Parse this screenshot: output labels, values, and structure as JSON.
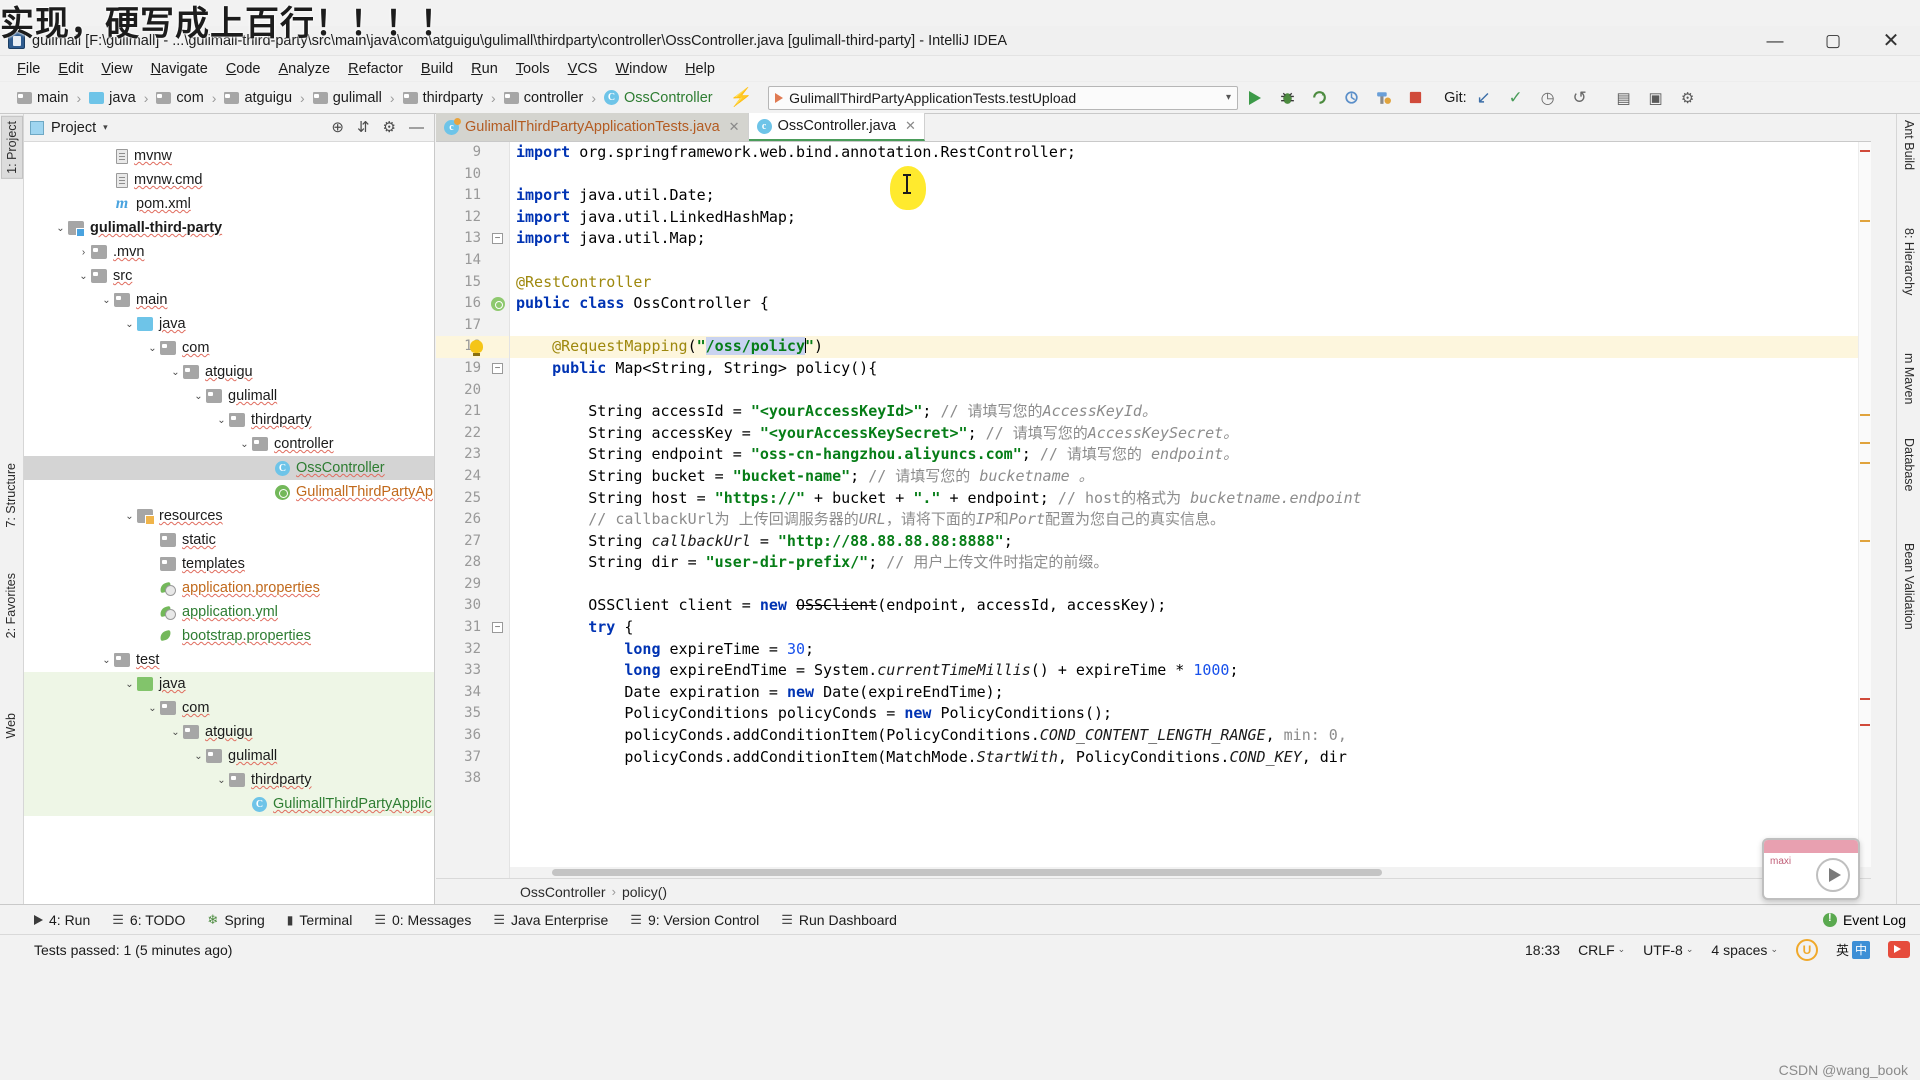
{
  "overlay": {
    "banner_text": "实现，硬写成上百行！！！！"
  },
  "titlebar": {
    "text": "gulimall [F:\\gulimall] - ...\\gulimall-third-party\\src\\main\\java\\com\\atguigu\\gulimall\\thirdparty\\controller\\OssController.java [gulimall-third-party] - IntelliJ IDEA",
    "app_icon": "intellij-idea-icon",
    "minimize": "—",
    "maximize": "▢",
    "close": "✕"
  },
  "menubar": {
    "items": [
      "File",
      "Edit",
      "View",
      "Navigate",
      "Code",
      "Analyze",
      "Refactor",
      "Build",
      "Run",
      "Tools",
      "VCS",
      "Window",
      "Help"
    ]
  },
  "navbar": {
    "breadcrumb": [
      {
        "label": "main",
        "icon": "folder-icon"
      },
      {
        "label": "java",
        "icon": "folder-source-icon"
      },
      {
        "label": "com",
        "icon": "folder-icon"
      },
      {
        "label": "atguigu",
        "icon": "folder-icon"
      },
      {
        "label": "gulimall",
        "icon": "folder-icon"
      },
      {
        "label": "thirdparty",
        "icon": "folder-icon"
      },
      {
        "label": "controller",
        "icon": "folder-icon"
      },
      {
        "label": "OssController",
        "icon": "java-class-icon"
      }
    ],
    "separator": "›",
    "lightning_icon": "lightning-bolt-icon",
    "run_config": {
      "name": "GulimallThirdPartyApplicationTests.testUpload",
      "chevron": "▾"
    },
    "buttons": [
      {
        "name": "run-button",
        "glyph": "▶"
      },
      {
        "name": "debug-button",
        "glyph": "🐞"
      },
      {
        "name": "run-coverage-button",
        "glyph": "⟳"
      },
      {
        "name": "profiler-button",
        "glyph": "⚙"
      },
      {
        "name": "build-project-button",
        "glyph": "🔨"
      },
      {
        "name": "stop-button",
        "glyph": "■"
      }
    ],
    "git_label": "Git:",
    "git_buttons": [
      {
        "name": "update-project-button",
        "glyph": "↙"
      },
      {
        "name": "commit-button",
        "glyph": "✓"
      },
      {
        "name": "history-button",
        "glyph": "◷"
      },
      {
        "name": "rollback-button",
        "glyph": "↺"
      }
    ],
    "right_buttons": [
      {
        "name": "layout-button",
        "glyph": "▦"
      },
      {
        "name": "search-everywhere-button",
        "glyph": "⌕"
      },
      {
        "name": "settings-button",
        "glyph": "⚙"
      }
    ]
  },
  "left_strip": {
    "tabs": [
      {
        "label": "1: Project",
        "active": true
      },
      {
        "label": "7: Structure",
        "active": false
      },
      {
        "label": "2: Favorites",
        "active": false
      },
      {
        "label": "Web",
        "active": false
      }
    ]
  },
  "right_strip": {
    "tabs": [
      {
        "label": "Ant Build"
      },
      {
        "label": "8: Hierarchy"
      },
      {
        "label": "m Maven"
      },
      {
        "label": "Database"
      },
      {
        "label": "Bean Validation"
      }
    ]
  },
  "project_panel": {
    "title": "Project",
    "chevron": "▾",
    "locate_icon": "crosshair-icon",
    "collapse_icon": "collapse-all-icon",
    "settings_icon": "gear-icon",
    "hide_icon": "minimize-icon",
    "tree": [
      {
        "label": "mvnw",
        "indent": 3,
        "arrow": "",
        "icon": "file-icon",
        "style": ""
      },
      {
        "label": "mvnw.cmd",
        "indent": 3,
        "arrow": "",
        "icon": "file-icon",
        "style": ""
      },
      {
        "label": "pom.xml",
        "indent": 3,
        "arrow": "",
        "icon": "maven-file-icon",
        "style": ""
      },
      {
        "label": "gulimall-third-party",
        "indent": 1,
        "arrow": "⌄",
        "icon": "module-folder-icon",
        "style": "bold"
      },
      {
        "label": ".mvn",
        "indent": 2,
        "arrow": "›",
        "icon": "folder-icon",
        "style": ""
      },
      {
        "label": "src",
        "indent": 2,
        "arrow": "⌄",
        "icon": "folder-icon",
        "style": ""
      },
      {
        "label": "main",
        "indent": 3,
        "arrow": "⌄",
        "icon": "folder-icon",
        "style": ""
      },
      {
        "label": "java",
        "indent": 4,
        "arrow": "⌄",
        "icon": "folder-source-icon",
        "style": ""
      },
      {
        "label": "com",
        "indent": 5,
        "arrow": "⌄",
        "icon": "folder-icon",
        "style": ""
      },
      {
        "label": "atguigu",
        "indent": 6,
        "arrow": "⌄",
        "icon": "folder-icon",
        "style": ""
      },
      {
        "label": "gulimall",
        "indent": 7,
        "arrow": "⌄",
        "icon": "folder-icon",
        "style": ""
      },
      {
        "label": "thirdparty",
        "indent": 8,
        "arrow": "⌄",
        "icon": "folder-icon",
        "style": ""
      },
      {
        "label": "controller",
        "indent": 9,
        "arrow": "⌄",
        "icon": "folder-icon",
        "style": ""
      },
      {
        "label": "OssController",
        "indent": 10,
        "arrow": "",
        "icon": "java-class-icon",
        "style": "selected-green"
      },
      {
        "label": "GulimallThirdPartyApplication",
        "indent": 10,
        "arrow": "",
        "icon": "spring-class-icon",
        "style": "orange"
      },
      {
        "label": "resources",
        "indent": 4,
        "arrow": "⌄",
        "icon": "resources-folder-icon",
        "style": ""
      },
      {
        "label": "static",
        "indent": 5,
        "arrow": "",
        "icon": "folder-icon",
        "style": ""
      },
      {
        "label": "templates",
        "indent": 5,
        "arrow": "",
        "icon": "folder-icon",
        "style": ""
      },
      {
        "label": "application.properties",
        "indent": 5,
        "arrow": "",
        "icon": "spring-config-icon",
        "style": "orange"
      },
      {
        "label": "application.yml",
        "indent": 5,
        "arrow": "",
        "icon": "spring-config-icon",
        "style": "green"
      },
      {
        "label": "bootstrap.properties",
        "indent": 5,
        "arrow": "",
        "icon": "spring-leaf-icon",
        "style": "green"
      },
      {
        "label": "test",
        "indent": 3,
        "arrow": "⌄",
        "icon": "folder-icon",
        "style": ""
      },
      {
        "label": "java",
        "indent": 4,
        "arrow": "⌄",
        "icon": "folder-test-icon",
        "style": "testrow"
      },
      {
        "label": "com",
        "indent": 5,
        "arrow": "⌄",
        "icon": "folder-icon",
        "style": "testrow"
      },
      {
        "label": "atguigu",
        "indent": 6,
        "arrow": "⌄",
        "icon": "folder-icon",
        "style": "testrow"
      },
      {
        "label": "gulimall",
        "indent": 7,
        "arrow": "⌄",
        "icon": "folder-icon",
        "style": "testrow"
      },
      {
        "label": "thirdparty",
        "indent": 8,
        "arrow": "⌄",
        "icon": "folder-icon",
        "style": "testrow"
      },
      {
        "label": "GulimallThirdPartyApplic",
        "indent": 9,
        "arrow": "",
        "icon": "java-class-icon",
        "style": "testrow-green"
      }
    ]
  },
  "editor": {
    "tabs": [
      {
        "label": "GulimallThirdPartyApplicationTests.java",
        "active": false,
        "close": "✕",
        "icon": "spring-test-class-icon"
      },
      {
        "label": "OssController.java",
        "active": true,
        "close": "✕",
        "icon": "java-class-icon"
      }
    ],
    "first_line_number": 9,
    "lines": [
      {
        "n": 9,
        "parts": [
          {
            "t": "import ",
            "c": "kw"
          },
          {
            "t": "org.springframework.web.bind.annotation.RestController;",
            "c": "plain"
          }
        ],
        "clipped": true
      },
      {
        "n": 10,
        "parts": []
      },
      {
        "n": 11,
        "parts": [
          {
            "t": "import ",
            "c": "kw"
          },
          {
            "t": "java.util.Date;",
            "c": "plain"
          }
        ]
      },
      {
        "n": 12,
        "parts": [
          {
            "t": "import ",
            "c": "kw"
          },
          {
            "t": "java.util.LinkedHashMap;",
            "c": "plain"
          }
        ]
      },
      {
        "n": 13,
        "parts": [
          {
            "t": "import ",
            "c": "kw"
          },
          {
            "t": "java.util.Map;",
            "c": "plain"
          }
        ],
        "fold": true
      },
      {
        "n": 14,
        "parts": []
      },
      {
        "n": 15,
        "parts": [
          {
            "t": "@RestController",
            "c": "an"
          }
        ]
      },
      {
        "n": 16,
        "parts": [
          {
            "t": "public ",
            "c": "kw"
          },
          {
            "t": "class ",
            "c": "kw"
          },
          {
            "t": "OssController {",
            "c": "plain"
          }
        ],
        "gutter_icon": "spring-bean-icon"
      },
      {
        "n": 17,
        "parts": []
      },
      {
        "n": 18,
        "parts": [
          {
            "t": "    ",
            "c": "plain"
          },
          {
            "t": "@RequestMapping",
            "c": "an"
          },
          {
            "t": "(",
            "c": "plain"
          },
          {
            "t": "\"",
            "c": "str"
          },
          {
            "t": "/oss/policy",
            "c": "str-sel"
          },
          {
            "t": "CARET",
            "c": "caret"
          },
          {
            "t": "\"",
            "c": "str"
          },
          {
            "t": ")",
            "c": "plain"
          }
        ],
        "highlight": true,
        "gutter_icon": "intention-bulb-icon"
      },
      {
        "n": 19,
        "parts": [
          {
            "t": "    ",
            "c": "plain"
          },
          {
            "t": "public ",
            "c": "kw"
          },
          {
            "t": "Map<String, String> policy(){",
            "c": "plain"
          }
        ],
        "fold": true
      },
      {
        "n": 20,
        "parts": []
      },
      {
        "n": 21,
        "parts": [
          {
            "t": "        String accessId = ",
            "c": "plain"
          },
          {
            "t": "\"<yourAccessKeyId>\"",
            "c": "str"
          },
          {
            "t": "; ",
            "c": "plain"
          },
          {
            "t": "// 请填写您的",
            "c": "cmt"
          },
          {
            "t": "AccessKeyId。",
            "c": "cmti"
          }
        ]
      },
      {
        "n": 22,
        "parts": [
          {
            "t": "        String accessKey = ",
            "c": "plain"
          },
          {
            "t": "\"<yourAccessKeySecret>\"",
            "c": "str"
          },
          {
            "t": "; ",
            "c": "plain"
          },
          {
            "t": "// 请填写您的",
            "c": "cmt"
          },
          {
            "t": "AccessKeySecret。",
            "c": "cmti"
          }
        ]
      },
      {
        "n": 23,
        "parts": [
          {
            "t": "        String endpoint = ",
            "c": "plain"
          },
          {
            "t": "\"oss-cn-hangzhou.aliyuncs.com\"",
            "c": "str"
          },
          {
            "t": "; ",
            "c": "plain"
          },
          {
            "t": "// 请填写您的 ",
            "c": "cmt"
          },
          {
            "t": "endpoint。",
            "c": "cmti"
          }
        ]
      },
      {
        "n": 24,
        "parts": [
          {
            "t": "        String bucket = ",
            "c": "plain"
          },
          {
            "t": "\"bucket-name\"",
            "c": "str"
          },
          {
            "t": "; ",
            "c": "plain"
          },
          {
            "t": "// 请填写您的 ",
            "c": "cmt"
          },
          {
            "t": "bucketname 。",
            "c": "cmti"
          }
        ]
      },
      {
        "n": 25,
        "parts": [
          {
            "t": "        String host = ",
            "c": "plain"
          },
          {
            "t": "\"https://\"",
            "c": "str"
          },
          {
            "t": " + bucket + ",
            "c": "plain"
          },
          {
            "t": "\".\"",
            "c": "str"
          },
          {
            "t": " + endpoint; ",
            "c": "plain"
          },
          {
            "t": "// host的格式为 ",
            "c": "cmt"
          },
          {
            "t": "bucketname.endpoint",
            "c": "cmti"
          }
        ]
      },
      {
        "n": 26,
        "parts": [
          {
            "t": "        ",
            "c": "plain"
          },
          {
            "t": "// callbackUrl为 上传回调服务器的",
            "c": "cmt"
          },
          {
            "t": "URL",
            "c": "cmti"
          },
          {
            "t": "，请将下面的",
            "c": "cmt"
          },
          {
            "t": "IP",
            "c": "cmti"
          },
          {
            "t": "和",
            "c": "cmt"
          },
          {
            "t": "Port",
            "c": "cmti"
          },
          {
            "t": "配置为您自己的真实信息。",
            "c": "cmt"
          }
        ]
      },
      {
        "n": 27,
        "parts": [
          {
            "t": "        String ",
            "c": "plain"
          },
          {
            "t": "callbackUrl",
            "c": "stat"
          },
          {
            "t": " = ",
            "c": "plain"
          },
          {
            "t": "\"http://88.88.88.88:8888\"",
            "c": "str"
          },
          {
            "t": ";",
            "c": "plain"
          }
        ]
      },
      {
        "n": 28,
        "parts": [
          {
            "t": "        String dir = ",
            "c": "plain"
          },
          {
            "t": "\"user-dir-prefix/\"",
            "c": "str"
          },
          {
            "t": "; ",
            "c": "plain"
          },
          {
            "t": "// 用户上传文件时指定的前缀。",
            "c": "cmt"
          }
        ]
      },
      {
        "n": 29,
        "parts": []
      },
      {
        "n": 30,
        "parts": [
          {
            "t": "        OSSClient client = ",
            "c": "plain"
          },
          {
            "t": "new ",
            "c": "kw"
          },
          {
            "t": "OSSClient",
            "c": "strike"
          },
          {
            "t": "(endpoint, accessId, accessKey);",
            "c": "plain"
          }
        ]
      },
      {
        "n": 31,
        "parts": [
          {
            "t": "        ",
            "c": "plain"
          },
          {
            "t": "try ",
            "c": "kw"
          },
          {
            "t": "{",
            "c": "plain"
          }
        ],
        "fold": true
      },
      {
        "n": 32,
        "parts": [
          {
            "t": "            ",
            "c": "plain"
          },
          {
            "t": "long ",
            "c": "kw"
          },
          {
            "t": "expireTime = ",
            "c": "plain"
          },
          {
            "t": "30",
            "c": "num"
          },
          {
            "t": ";",
            "c": "plain"
          }
        ]
      },
      {
        "n": 33,
        "parts": [
          {
            "t": "            ",
            "c": "plain"
          },
          {
            "t": "long ",
            "c": "kw"
          },
          {
            "t": "expireEndTime = System.",
            "c": "plain"
          },
          {
            "t": "currentTimeMillis",
            "c": "stat"
          },
          {
            "t": "() + expireTime * ",
            "c": "plain"
          },
          {
            "t": "1000",
            "c": "num"
          },
          {
            "t": ";",
            "c": "plain"
          }
        ]
      },
      {
        "n": 34,
        "parts": [
          {
            "t": "            Date expiration = ",
            "c": "plain"
          },
          {
            "t": "new ",
            "c": "kw"
          },
          {
            "t": "Date(expireEndTime);",
            "c": "plain"
          }
        ]
      },
      {
        "n": 35,
        "parts": [
          {
            "t": "            PolicyConditions policyConds = ",
            "c": "plain"
          },
          {
            "t": "new ",
            "c": "kw"
          },
          {
            "t": "PolicyConditions();",
            "c": "plain"
          }
        ]
      },
      {
        "n": 36,
        "parts": [
          {
            "t": "            policyConds.addConditionItem(PolicyConditions.",
            "c": "plain"
          },
          {
            "t": "COND_CONTENT_LENGTH_RANGE",
            "c": "stat"
          },
          {
            "t": ", ",
            "c": "plain"
          },
          {
            "t": "min: 0,",
            "c": "cmt"
          }
        ]
      },
      {
        "n": 37,
        "parts": [
          {
            "t": "            policyConds.addConditionItem(MatchMode.",
            "c": "plain"
          },
          {
            "t": "StartWith",
            "c": "stat"
          },
          {
            "t": ", PolicyConditions.",
            "c": "plain"
          },
          {
            "t": "COND_KEY",
            "c": "stat"
          },
          {
            "t": ", dir",
            "c": "plain"
          }
        ]
      },
      {
        "n": 38,
        "parts": []
      }
    ],
    "breadcrumb": [
      "OssController",
      "policy()"
    ],
    "breadcrumb_sep": "›"
  },
  "video_bubble": {
    "label": "maxi",
    "play_icon": "play-icon"
  },
  "bottom_bar": {
    "items": [
      {
        "label": "4: Run",
        "icon": "run-icon"
      },
      {
        "label": "6: TODO",
        "icon": "todo-icon"
      },
      {
        "label": "Spring",
        "icon": "spring-icon"
      },
      {
        "label": "Terminal",
        "icon": "terminal-icon"
      },
      {
        "label": "0: Messages",
        "icon": "messages-icon"
      },
      {
        "label": "Java Enterprise",
        "icon": "java-enterprise-icon"
      },
      {
        "label": "9: Version Control",
        "icon": "version-control-icon"
      },
      {
        "label": "Run Dashboard",
        "icon": "dashboard-icon"
      }
    ],
    "event_log": {
      "label": "Event Log",
      "icon": "event-log-icon"
    }
  },
  "status_bar": {
    "message": "Tests passed: 1 (5 minutes ago)",
    "position": "18:33",
    "line_separator": "CRLF",
    "encoding": "UTF-8",
    "indent": "4 spaces",
    "caret": "⌄",
    "ime": {
      "u_icon": "u-circle-icon",
      "cn_label": "英",
      "box_label": "中",
      "tv_icon": "tv-icon"
    },
    "watermark": "CSDN @wang_book"
  }
}
